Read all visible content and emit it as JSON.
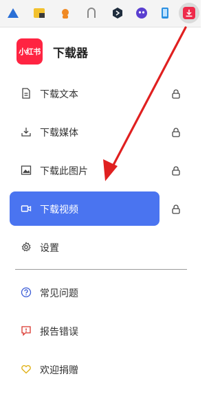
{
  "toolbar": {
    "extensions": [
      {
        "icon": "triangle-app-icon"
      },
      {
        "icon": "spreadsheet-ext-icon"
      },
      {
        "icon": "fox-ext-icon"
      },
      {
        "icon": "ghost-ext-icon"
      },
      {
        "icon": "hexagon-ext-icon"
      },
      {
        "icon": "face-ext-icon"
      },
      {
        "icon": "phone-ext-icon"
      },
      {
        "icon": "download-ext-icon"
      }
    ]
  },
  "header": {
    "logo_text": "小红书",
    "title": "下载器",
    "brand_color": "#ff2442"
  },
  "menu": {
    "items": [
      {
        "label": "下载文本",
        "icon": "document-icon",
        "locked": true
      },
      {
        "label": "下载媒体",
        "icon": "download-icon",
        "locked": true
      },
      {
        "label": "下载此图片",
        "icon": "image-icon",
        "locked": true
      },
      {
        "label": "下载视频",
        "icon": "video-icon",
        "locked": true,
        "active": true
      },
      {
        "label": "设置",
        "icon": "gear-icon",
        "locked": false
      }
    ],
    "active_color": "#4a74f0"
  },
  "footer": {
    "items": [
      {
        "label": "常见问题",
        "icon": "question-icon"
      },
      {
        "label": "报告错误",
        "icon": "report-icon"
      },
      {
        "label": "欢迎捐赠",
        "icon": "heart-icon"
      }
    ]
  },
  "annotation": {
    "arrow_color": "#e02020"
  }
}
